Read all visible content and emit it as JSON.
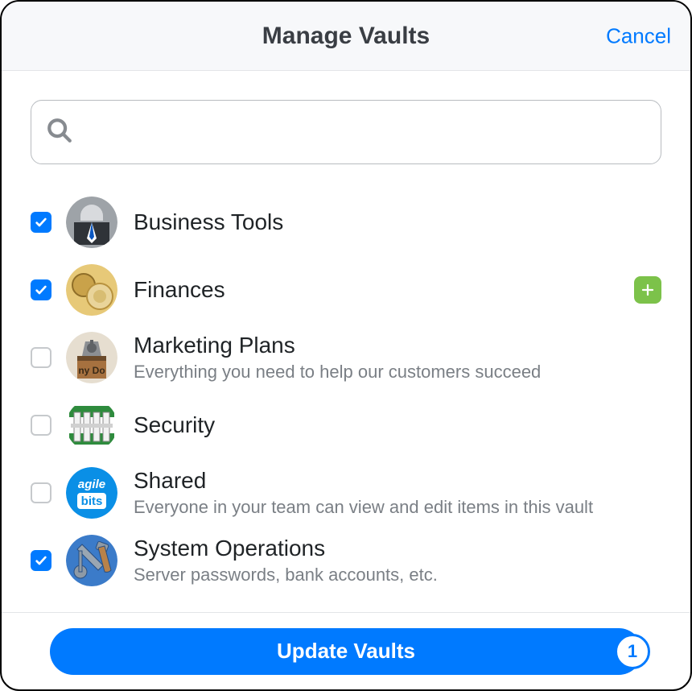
{
  "header": {
    "title": "Manage Vaults",
    "cancel_label": "Cancel"
  },
  "search": {
    "placeholder": "",
    "value": ""
  },
  "vaults": [
    {
      "id": "business-tools",
      "name": "Business Tools",
      "description": "",
      "checked": true,
      "badge": null,
      "icon": "suit-icon"
    },
    {
      "id": "finances",
      "name": "Finances",
      "description": "",
      "checked": true,
      "badge": "add",
      "icon": "coins-icon"
    },
    {
      "id": "marketing-plans",
      "name": "Marketing Plans",
      "description": "Everything you need to help our customers succeed",
      "checked": false,
      "badge": null,
      "icon": "binder-icon"
    },
    {
      "id": "security",
      "name": "Security",
      "description": "",
      "checked": false,
      "badge": null,
      "icon": "fence-icon"
    },
    {
      "id": "shared",
      "name": "Shared",
      "description": "Everyone in your team can view and edit items in this vault",
      "checked": false,
      "badge": null,
      "icon": "agilebits-icon"
    },
    {
      "id": "system-operations",
      "name": "System Operations",
      "description": "Server passwords, bank accounts, etc.",
      "checked": true,
      "badge": null,
      "icon": "tools-icon"
    }
  ],
  "footer": {
    "update_label": "Update Vaults",
    "pending_count": "1"
  }
}
